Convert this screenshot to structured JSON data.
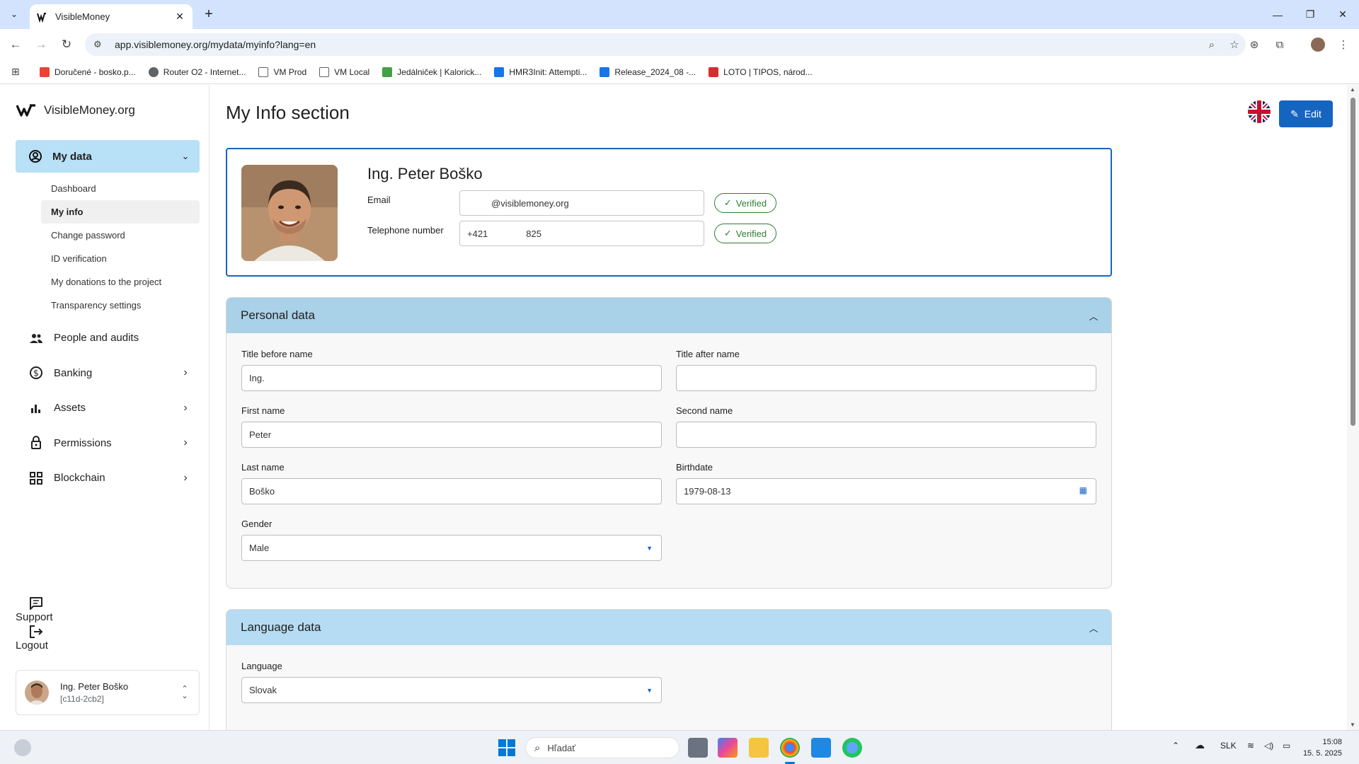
{
  "browser": {
    "tab_title": "VisibleMoney",
    "url": "app.visiblemoney.org/mydata/myinfo?lang=en",
    "bookmarks": [
      {
        "label": "Doručené - bosko.p...",
        "color": "#ea4335"
      },
      {
        "label": "Router O2 - Internet...",
        "color": "#5f6368"
      },
      {
        "label": "VM Prod",
        "color": "#5f6368"
      },
      {
        "label": "VM Local",
        "color": "#5f6368"
      },
      {
        "label": "Jedálniček | Kalorick...",
        "color": "#43a047"
      },
      {
        "label": "HMR3Init: Attempti...",
        "color": "#1a73e8"
      },
      {
        "label": "Release_2024_08 -...",
        "color": "#1a73e8"
      },
      {
        "label": "LOTO | TIPOS, národ...",
        "color": "#d32f2f"
      }
    ]
  },
  "sidebar": {
    "brand": "VisibleMoney.org",
    "active_section": "My data",
    "sub_items": [
      "Dashboard",
      "My info",
      "Change password",
      "ID verification",
      "My donations to the project",
      "Transparency settings"
    ],
    "active_sub": "My info",
    "nav_items": [
      {
        "label": "People and audits",
        "icon": "people-icon"
      },
      {
        "label": "Banking",
        "icon": "banking-icon"
      },
      {
        "label": "Assets",
        "icon": "assets-icon"
      },
      {
        "label": "Permissions",
        "icon": "lock-icon"
      },
      {
        "label": "Blockchain",
        "icon": "blockchain-icon"
      }
    ],
    "bottom_items": [
      "Support",
      "Logout"
    ],
    "user": {
      "name": "Ing. Peter Boško",
      "id": "[c11d-2cb2]"
    }
  },
  "main": {
    "title": "My Info section",
    "edit_label": "Edit",
    "profile": {
      "name": "Ing. Peter Boško",
      "email_label": "Email",
      "email_value": "@visiblemoney.org",
      "email_status": "Verified",
      "phone_label": "Telephone number",
      "phone_prefix": "+421",
      "phone_suffix": "825",
      "phone_status": "Verified"
    },
    "personal": {
      "heading": "Personal data",
      "title_before_label": "Title before name",
      "title_before_value": "Ing.",
      "title_after_label": "Title after name",
      "title_after_value": "",
      "first_name_label": "First name",
      "first_name_value": "Peter",
      "second_name_label": "Second name",
      "second_name_value": "",
      "last_name_label": "Last name",
      "last_name_value": "Boško",
      "birthdate_label": "Birthdate",
      "birthdate_value": "1979-08-13",
      "gender_label": "Gender",
      "gender_value": "Male"
    },
    "language": {
      "heading": "Language data",
      "language_label": "Language",
      "language_value": "Slovak"
    }
  },
  "taskbar": {
    "search_placeholder": "Hľadať",
    "lang": "SLK",
    "time": "15:08",
    "date": "15. 5. 2025"
  },
  "colors": {
    "accent": "#1565c0",
    "nav_active": "#b8e0f6",
    "verified": "#2e7d32"
  }
}
